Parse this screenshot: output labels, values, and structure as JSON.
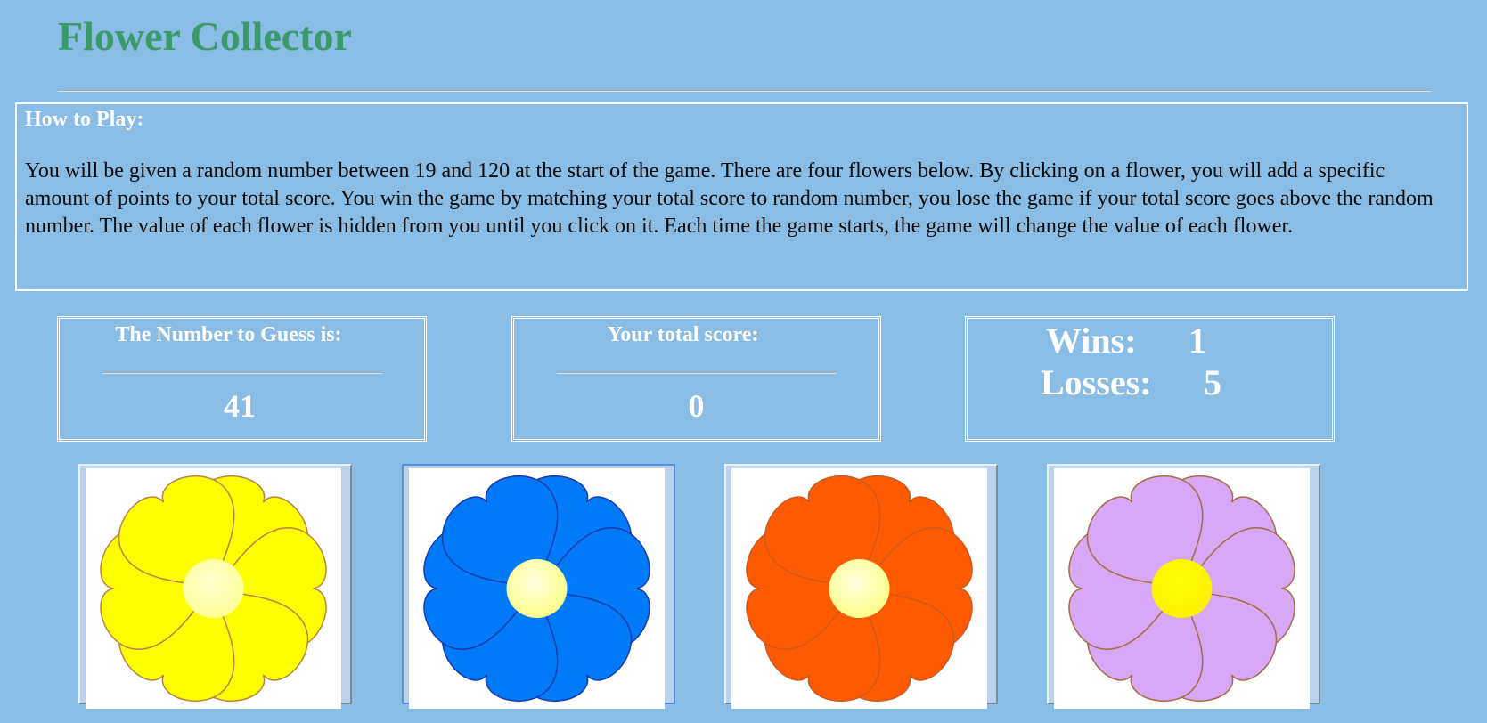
{
  "header": {
    "title": "Flower Collector"
  },
  "instructions": {
    "heading": "How to Play:",
    "body": "You will be given a random number between 19 and 120 at the start of the game. There are four flowers below. By clicking on a flower, you will add a specific amount of points to your total score. You win the game by matching your total score to random number, you lose the game if your total score goes above the random number. The value of each flower is hidden from you until you click on it. Each time the game starts, the game will change the value of each flower."
  },
  "target": {
    "label": "The Number to Guess is:",
    "value": "41"
  },
  "score": {
    "label": "Your total score:",
    "value": "0"
  },
  "stats": {
    "wins_label": "Wins:",
    "wins": "1",
    "losses_label": "Losses:",
    "losses": "5"
  },
  "flowers": [
    {
      "name": "yellow-flower",
      "petal_outer": "#ffff00",
      "petal_inner": "#ffffc8",
      "center_outer": "#ffff99",
      "center_inner": "#ffffd0",
      "stroke": "#b8824a"
    },
    {
      "name": "blue-flower",
      "petal_outer": "#007af8",
      "petal_inner": "#007af8",
      "center_outer": "#ffff88",
      "center_inner": "#ffffe0",
      "stroke": "#1a3aa8"
    },
    {
      "name": "orange-flower",
      "petal_outer": "#ff5a00",
      "petal_inner": "#ffe000",
      "center_outer": "#ffff88",
      "center_inner": "#ffffe0",
      "stroke": "#c85a20"
    },
    {
      "name": "purple-flower",
      "petal_outer": "#d7a8f8",
      "petal_inner": "#d7a8f8",
      "center_outer": "#fff000",
      "center_inner": "#ffff00",
      "stroke": "#a86a40"
    }
  ],
  "theme": {
    "background": "#89bde6",
    "title_color": "#3a9a6a"
  }
}
